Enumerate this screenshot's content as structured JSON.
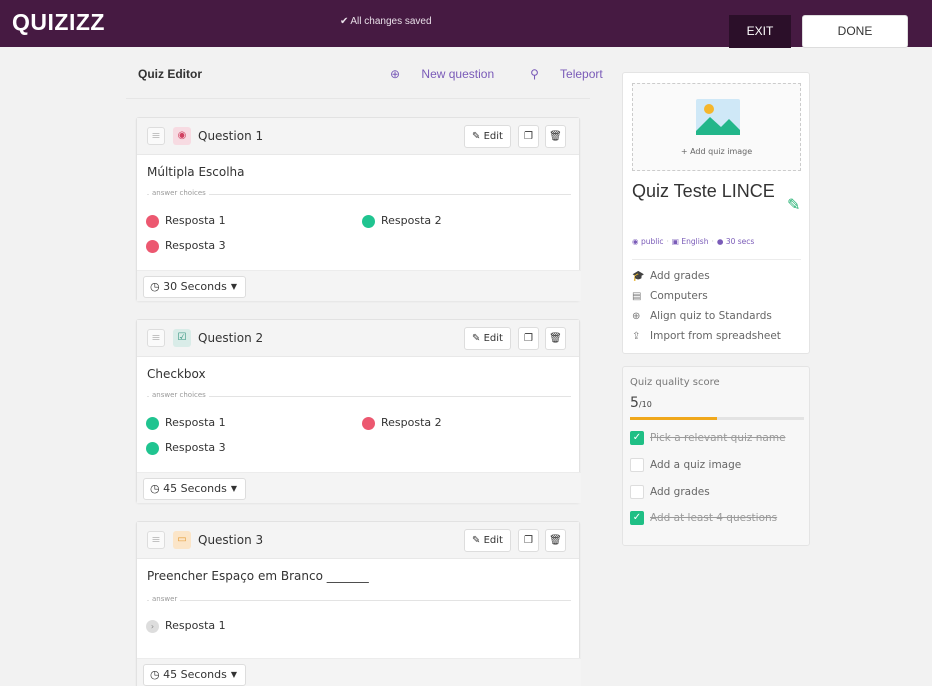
{
  "header": {
    "logo": "QUIZIZZ",
    "saved_text": "All changes saved",
    "exit_label": "EXIT",
    "done_label": "DONE"
  },
  "editor": {
    "title": "Quiz Editor",
    "new_question": "New question",
    "teleport": "Teleport"
  },
  "questions": [
    {
      "label": "Question 1",
      "type_icon": "radio-icon",
      "text": "Múltipla Escolha",
      "answers_label": "answer choices",
      "answers": [
        {
          "text": "Resposta 1",
          "correct": false
        },
        {
          "text": "Resposta 2",
          "correct": true
        },
        {
          "text": "Resposta 3",
          "correct": false
        }
      ],
      "time": "30 Seconds",
      "edit": "Edit"
    },
    {
      "label": "Question 2",
      "type_icon": "checkbox-icon",
      "text": "Checkbox",
      "answers_label": "answer choices",
      "answers": [
        {
          "text": "Resposta 1",
          "correct": true
        },
        {
          "text": "Resposta 2",
          "correct": false
        },
        {
          "text": "Resposta 3",
          "correct": true
        }
      ],
      "time": "45 Seconds",
      "edit": "Edit"
    },
    {
      "label": "Question 3",
      "type_icon": "blank-icon",
      "text": "Preencher Espaço em Branco _______",
      "answers_label": "answer",
      "answers": [
        {
          "text": "Resposta 1"
        }
      ],
      "time": "45 Seconds",
      "edit": "Edit"
    }
  ],
  "quiz": {
    "add_image": "+ Add quiz image",
    "name": "Quiz Teste LINCE",
    "visibility": "public",
    "language": "English",
    "time": "30 secs",
    "links": [
      "Add grades",
      "Computers",
      "Align quiz to Standards",
      "Import from spreadsheet"
    ]
  },
  "quality": {
    "title": "Quiz quality score",
    "score": "5",
    "max": "/10",
    "fraction": 0.5,
    "items": [
      {
        "text": "Pick a relevant quiz name",
        "done": true
      },
      {
        "text": "Add a quiz image",
        "done": false
      },
      {
        "text": "Add grades",
        "done": false
      },
      {
        "text": "Add at least 4 questions",
        "done": true
      }
    ]
  },
  "colors": {
    "brand": "#461a42",
    "accent": "#7a5bb8",
    "correct": "#20c490",
    "wrong": "#ec5870",
    "progress": "#f0a81c"
  }
}
